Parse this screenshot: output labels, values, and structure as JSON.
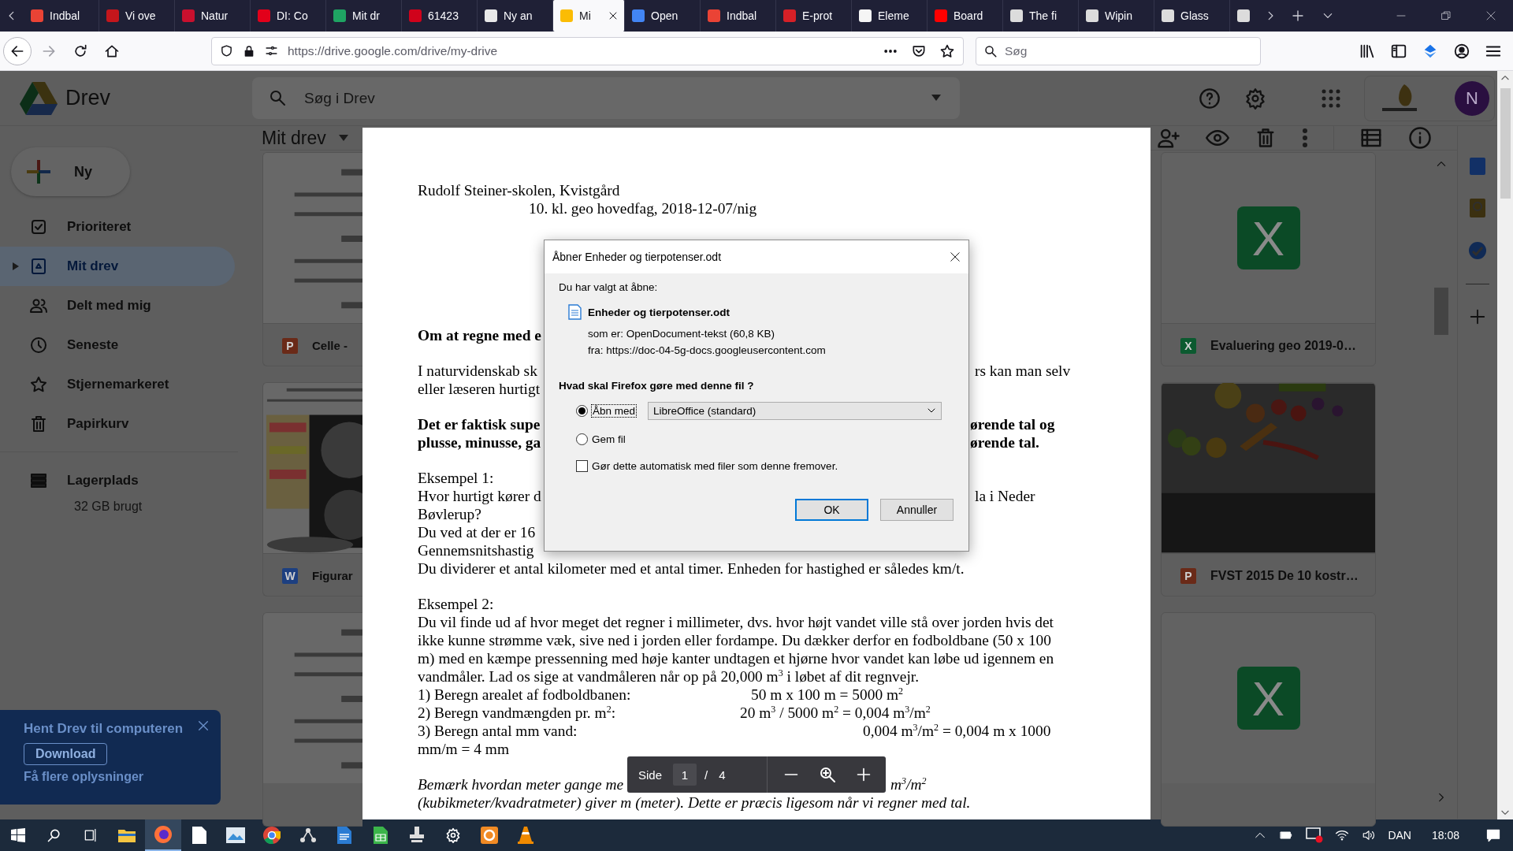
{
  "browser": {
    "tabs": [
      {
        "title": "Indbal",
        "color": "#ea4335",
        "selected": false
      },
      {
        "title": "Vi ove",
        "color": "#c4161c",
        "selected": false
      },
      {
        "title": "Natur",
        "color": "#c8102e",
        "selected": false
      },
      {
        "title": "DI: Co",
        "color": "#e2001a",
        "selected": false
      },
      {
        "title": "Mit dr",
        "color": "#1fa463",
        "selected": false
      },
      {
        "title": "61423",
        "color": "#d0021b",
        "selected": false
      },
      {
        "title": "Ny an",
        "color": "#e8e8e8",
        "selected": false
      },
      {
        "title": "Mi",
        "color": "#fbbc04",
        "selected": true
      },
      {
        "title": "Open",
        "color": "#4285f4",
        "selected": false
      },
      {
        "title": "Indbal",
        "color": "#ea4335",
        "selected": false
      },
      {
        "title": "E-prot",
        "color": "#d62027",
        "selected": false
      },
      {
        "title": "Eleme",
        "color": "#f5f5f5",
        "selected": false
      },
      {
        "title": "Board",
        "color": "#ff0000",
        "selected": false
      },
      {
        "title": "The fi",
        "color": "#dcdcdc",
        "selected": false
      },
      {
        "title": "Wipin",
        "color": "#dcdcdc",
        "selected": false
      },
      {
        "title": "Glass",
        "color": "#dcdcdc",
        "selected": false
      },
      {
        "color": "#dcdcdc",
        "selected": false
      }
    ],
    "url": "https://drive.google.com/drive/my-drive",
    "search_placeholder": "Søg"
  },
  "drive": {
    "app_name": "Drev",
    "search_placeholder": "Søg i Drev",
    "avatar": "N",
    "new_button": "Ny",
    "nav": [
      {
        "label": "Prioriteret",
        "selected": false
      },
      {
        "label": "Mit drev",
        "selected": true
      },
      {
        "label": "Delt med mig",
        "selected": false
      },
      {
        "label": "Seneste",
        "selected": false
      },
      {
        "label": "Stjernemarkeret",
        "selected": false
      },
      {
        "label": "Papirkurv",
        "selected": false
      }
    ],
    "storage_label": "Lagerplads",
    "storage_used": "32 GB brugt",
    "promo": {
      "title": "Hent Drev til computeren",
      "button": "Download",
      "link": "Få flere oplysninger"
    },
    "folder_title": "Mit drev",
    "files_left": [
      {
        "name": "Celle -",
        "type_letter": "P",
        "kind": "document"
      },
      {
        "name": "Figurar",
        "type_letter": "W",
        "kind": "figures"
      },
      {
        "kind": "document"
      }
    ],
    "files_right": [
      {
        "name": "Evaluering geo 2019-0…",
        "type_letter": "X",
        "kind": "sheet",
        "thumbnail_letter": "X"
      },
      {
        "name": "FVST 2015 De 10 kostr…",
        "type_letter": "P",
        "kind": "picture"
      },
      {
        "kind": "sheet",
        "thumbnail_letter": "X"
      }
    ]
  },
  "viewer": {
    "paragraphs": [
      {
        "kind": "header",
        "lines": [
          {
            "text": "Rudolf Steiner-skolen, Kvistgård"
          },
          {
            "text": "10. kl. geo hovedfag, 2018-12-07/nig"
          }
        ]
      },
      {
        "kind": "bold",
        "lines": [
          {
            "text": "Om at regne med e"
          }
        ]
      },
      {
        "kind": "body",
        "lines": [
          {
            "text": "I naturvidenskab sk",
            "tail": "rs kan man selv"
          },
          {
            "text": "eller læseren hurtigt"
          }
        ]
      },
      {
        "kind": "bold",
        "lines": [
          {
            "text": "Det er faktisk supe",
            "tail": "ørende tal og"
          },
          {
            "text": "plusse, minusse, ga",
            "tail": "ørende tal."
          }
        ]
      },
      {
        "kind": "body",
        "lines": [
          {
            "text": "Eksempel 1:"
          },
          {
            "text": "Hvor hurtigt kører d",
            "tail": "la i Neder"
          },
          {
            "text": "Bøvlerup?"
          },
          {
            "text": "Du ved at der er 16"
          },
          {
            "text": "Gennemsnitshastig"
          },
          {
            "text": "Du dividerer et antal kilometer med et antal timer. Enheden for hastighed er således km/t."
          }
        ]
      },
      {
        "kind": "body",
        "lines": [
          {
            "text": "Eksempel 2:"
          },
          {
            "text": "Du vil finde ud af hvor meget det regner i millimeter, dvs. hvor højt vandet ville stå over jorden hvis det"
          },
          {
            "text": "ikke kunne strømme væk, sive ned i jorden eller fordampe. Du dækker derfor en fodboldbane (50 x 100"
          },
          {
            "text": "m) med en kæmpe pressenning med høje kanter undtagen et hjørne hvor vandet kan løbe ud igennem en"
          },
          {
            "text": "vandmåler. Lad os sige at vandmåleren når op på 20,000 m$^{3}$ i løbet af dit regnvejr."
          },
          {
            "text": "1) Beregn arealet af fodboldbanen:",
            "tail": "50 m x 100 m = 5000 m$^{2}$"
          },
          {
            "text": "2) Beregn vandmængden pr. m$^{2}$:",
            "tail": "20 m$^{3}$ / 5000 m$^{2}$ = 0,004 m$^{3}$/m$^{2}$"
          },
          {
            "text": "3) Beregn antal mm vand:",
            "tail": "0,004 m$^{3}$/m$^{2}$ = 0,004 m x 1000"
          },
          {
            "text": "mm/m  = 4 mm"
          }
        ]
      },
      {
        "kind": "italic",
        "lines": [
          {
            "text": "Bemærk hvordan meter gange me",
            "tail": "m$^{3}$/m$^{2}$"
          },
          {
            "text": "(kubikmeter/kvadratmeter) giver m (meter). Dette er præcis ligesom når vi regner med tal."
          }
        ]
      }
    ],
    "toolbar": {
      "page_label": "Side",
      "page": "1",
      "separator": "/",
      "pages": "4"
    }
  },
  "dialog": {
    "title": "Åbner Enheder og tierpotenser.odt",
    "intro": "Du har valgt at åbne:",
    "file_name": "Enheder og tierpotenser.odt",
    "file_type": "som er: OpenDocument-tekst (60,8 KB)",
    "source": "fra: https://doc-04-5g-docs.googleusercontent.com",
    "question": "Hvad skal Firefox gøre med denne fil ?",
    "options": [
      {
        "label": "Åbn med",
        "kind": "app",
        "selected": true
      },
      {
        "label": "Gem fil",
        "kind": "save",
        "selected": false
      }
    ],
    "app": "LibreOffice (standard)",
    "remember": {
      "label": "Gør dette automatisk med filer som denne fremover.",
      "checked": false
    },
    "buttons": [
      {
        "label": "OK",
        "default": true
      },
      {
        "label": "Annuller",
        "default": false
      }
    ]
  },
  "taskbar": {
    "language": "DAN",
    "time": "18:08"
  }
}
